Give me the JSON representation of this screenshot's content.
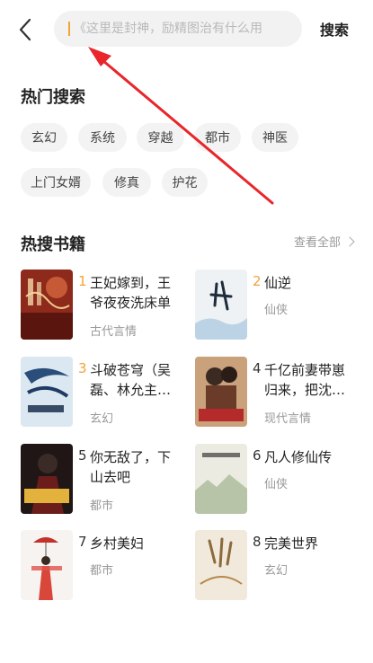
{
  "search": {
    "placeholder": "《这里是封神，励精图治有什么用",
    "submit_label": "搜索"
  },
  "hot_search": {
    "title": "热门搜索",
    "tags": [
      "玄幻",
      "系统",
      "穿越",
      "都市",
      "神医",
      "上门女婿",
      "修真",
      "护花"
    ]
  },
  "hot_books": {
    "title": "热搜书籍",
    "view_all_label": "查看全部",
    "items": [
      {
        "rank": "1",
        "title": "王妃嫁到，王爷夜夜洗床单",
        "genre": "古代言情",
        "cover_color": "#8e2a1c"
      },
      {
        "rank": "2",
        "title": "仙逆",
        "genre": "仙侠",
        "cover_color": "#dfe7ee"
      },
      {
        "rank": "3",
        "title": "斗破苍穹（吴磊、林允主…",
        "genre": "玄幻",
        "cover_color": "#d9e6f0"
      },
      {
        "rank": "4",
        "title": "千亿前妻带崽归来，把沈…",
        "genre": "现代言情",
        "cover_color": "#c9a17a"
      },
      {
        "rank": "5",
        "title": "你无敌了，下山去吧",
        "genre": "都市",
        "cover_color": "#2a1c1a"
      },
      {
        "rank": "6",
        "title": "凡人修仙传",
        "genre": "仙侠",
        "cover_color": "#e8e8dd"
      },
      {
        "rank": "7",
        "title": "乡村美妇",
        "genre": "都市",
        "cover_color": "#f4f1ef"
      },
      {
        "rank": "8",
        "title": "完美世界",
        "genre": "玄幻",
        "cover_color": "#efe6d8"
      }
    ]
  },
  "colors": {
    "accent": "#f2a33a",
    "annotation_arrow": "#e8262b"
  }
}
